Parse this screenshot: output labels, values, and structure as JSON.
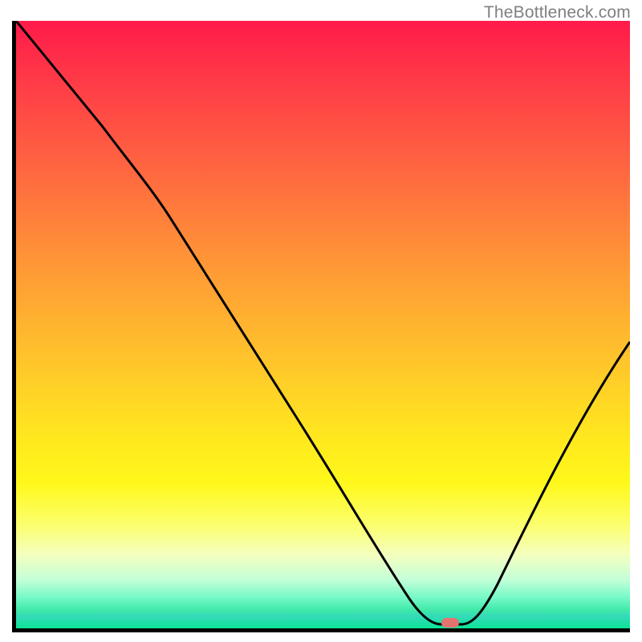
{
  "watermark": "TheBottleneck.com",
  "chart_data": {
    "type": "line",
    "title": "",
    "xlabel": "",
    "ylabel": "",
    "xlim": [
      0,
      100
    ],
    "ylim": [
      0,
      100
    ],
    "grid": false,
    "series": [
      {
        "name": "curve",
        "x": [
          0,
          15,
          25,
          35,
          45,
          55,
          63,
          67,
          70,
          73,
          80,
          90,
          100
        ],
        "values": [
          100,
          82,
          71,
          58,
          44,
          30,
          14,
          4,
          1,
          1,
          10,
          29,
          47
        ]
      }
    ],
    "marker": {
      "x": 70,
      "y": 0.5,
      "color": "#e4736f"
    },
    "background_gradient": {
      "stops": [
        {
          "pos": 0.0,
          "color": "#ff1a4a"
        },
        {
          "pos": 0.5,
          "color": "#ffc22c"
        },
        {
          "pos": 0.8,
          "color": "#fcff6e"
        },
        {
          "pos": 1.0,
          "color": "#0be594"
        }
      ]
    }
  }
}
